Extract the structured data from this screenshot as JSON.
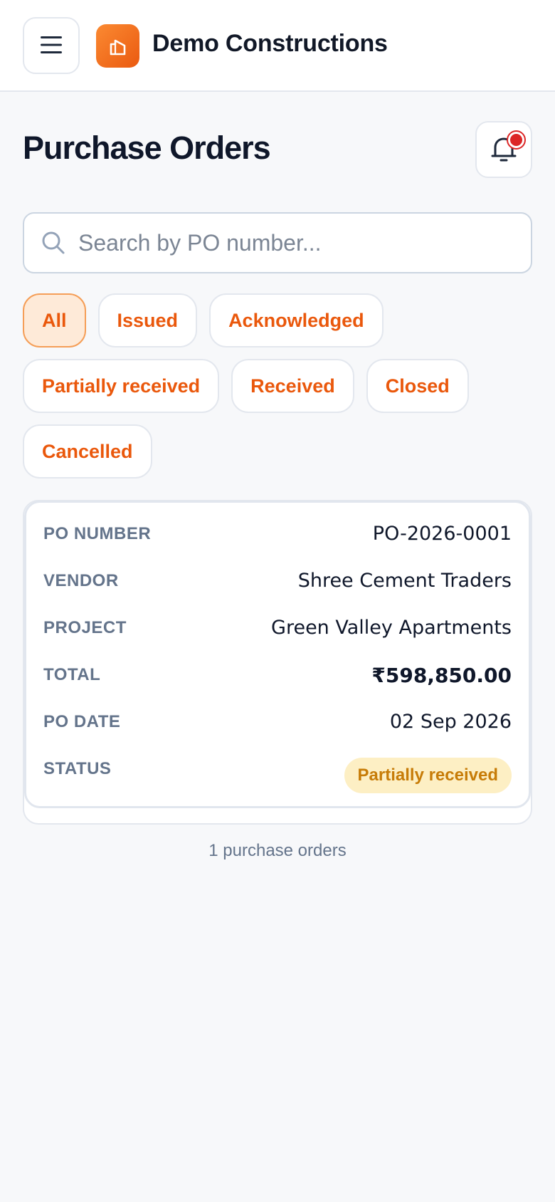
{
  "app": {
    "company_name": "Demo Constructions",
    "brand_color": "#f97316"
  },
  "page": {
    "title": "Purchase Orders",
    "notification_badge": "red-dot"
  },
  "search": {
    "placeholder": "Search by PO number...",
    "value": ""
  },
  "filters": {
    "selected": "All",
    "items": [
      {
        "label": "All"
      },
      {
        "label": "Issued"
      },
      {
        "label": "Acknowledged"
      },
      {
        "label": "Partially received"
      },
      {
        "label": "Received"
      },
      {
        "label": "Closed"
      },
      {
        "label": "Cancelled"
      }
    ]
  },
  "orders": [
    {
      "po_number_label": "PO NUMBER",
      "po_number": "PO-2026-0001",
      "vendor_label": "VENDOR",
      "vendor": "Shree Cement Traders",
      "project_label": "PROJECT",
      "project": "Green Valley Apartments",
      "total_label": "TOTAL",
      "total": "₹598,850.00",
      "po_date_label": "PO DATE",
      "po_date": "02 Sep 2026",
      "status_label": "STATUS",
      "status": "Partially received",
      "status_color": "#fdefc4"
    }
  ],
  "summary": {
    "count_text": "1 purchase orders"
  },
  "icons": {
    "menu": "hamburger-icon",
    "logo": "building-logo-icon",
    "notifications": "bell-icon",
    "search": "search-icon"
  }
}
